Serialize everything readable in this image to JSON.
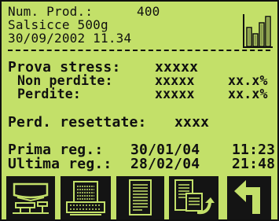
{
  "product": {
    "num_label": "Num. Prod.:",
    "num_value": "400",
    "name": "Salsicce 500g",
    "datetime": "30/09/2002 11.34"
  },
  "stress": {
    "title_label": "Prova stress:",
    "title_value": "xxxxx",
    "non_lost_label": "Non perdite:",
    "non_lost_value": "xxxxx",
    "non_lost_pct": "xx.x%",
    "lost_label": "Perdite:",
    "lost_value": "xxxxx",
    "lost_pct": "xx.x%"
  },
  "reset": {
    "label": "Perd. resettate:",
    "value": "xxxx"
  },
  "records": {
    "first_label": "Prima reg.:",
    "first_date": "30/01/04",
    "first_time": "11:23",
    "last_label": "Ultima reg.:",
    "last_date": "28/02/04",
    "last_time": "21:48"
  },
  "icons": {
    "header": "bar-chart-icon",
    "keys": [
      "scale-icon",
      "printer-icon",
      "report-icon",
      "export-report-icon",
      "back-arrow-icon"
    ]
  },
  "colors": {
    "screen_bg": "#c3e069",
    "ink": "#101010",
    "key_bg": "#141414"
  }
}
